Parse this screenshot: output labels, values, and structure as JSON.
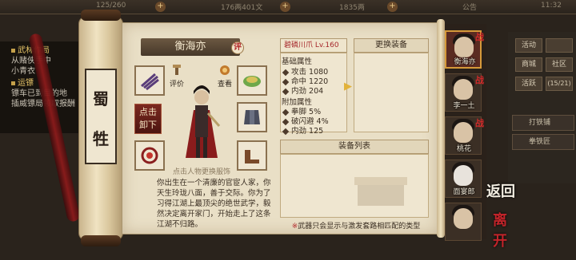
{
  "top_bar": {
    "resource1": "125/260",
    "resource2": "176两401文",
    "resource3": "1835两",
    "menu_label": "公告",
    "clock": "11:32"
  },
  "quests": [
    {
      "title": "武林作局",
      "sub": "从赌侠手中"
    },
    {
      "title": "",
      "sub": "小青衣"
    },
    {
      "title": "运镖",
      "sub": "镖车已到目的地"
    },
    {
      "title": "",
      "sub": "插威镖局领取报酬"
    }
  ],
  "side_buttons": [
    "活动",
    "商城",
    "社区",
    "活跃"
  ],
  "side_badge": "(15/21)",
  "side_long_buttons": [
    "打铁铺",
    "拳铁匠"
  ],
  "scroll_name": [
    "蜀",
    "牲"
  ],
  "character": {
    "name": "衡海亦",
    "review_label": "评",
    "action_left": "评价",
    "action_right": "查看",
    "unequip_label_line1": "点击",
    "unequip_label_line2": "卸下",
    "tap_hint": "点击人物更换服饰",
    "bio": "你出生在一个清廉的官宦人家，你天生玲珑八面，善于交际。你为了习得江湖上最顶尖的绝世武学，毅然决定离开家门，开始走上了这条江湖不归路。"
  },
  "weapon": {
    "name": "碧磷川爪 Lv.160"
  },
  "base_stats": {
    "title": "基础属性",
    "rows": [
      {
        "label": "攻击",
        "value": "1080"
      },
      {
        "label": "命中",
        "value": "1220"
      },
      {
        "label": "内劲",
        "value": "204"
      }
    ]
  },
  "extra_stats": {
    "title": "附加属性",
    "rows": [
      {
        "label": "拳脚",
        "value": "5%"
      },
      {
        "label": "破闪避",
        "value": "4%"
      },
      {
        "label": "内劲",
        "value": "125"
      }
    ]
  },
  "swap_header": "更换装备",
  "list_header": "装备列表",
  "list_note_prefix": "※",
  "list_note": "武器只会显示与激发套路相匹配的类型",
  "roster": [
    {
      "name": "衡海亦",
      "tag": "战",
      "active": true
    },
    {
      "name": "李一土",
      "tag": "战",
      "active": false
    },
    {
      "name": "桃花",
      "tag": "战",
      "active": false
    },
    {
      "name": "面宴郎",
      "tag": "",
      "active": false
    },
    {
      "name": "",
      "tag": "",
      "active": false
    }
  ],
  "back_button": {
    "line1": "返回",
    "line2": "离开"
  },
  "colors": {
    "accent_red": "#b1282a",
    "paper": "#e9dfc6",
    "gold": "#e2b23a"
  }
}
